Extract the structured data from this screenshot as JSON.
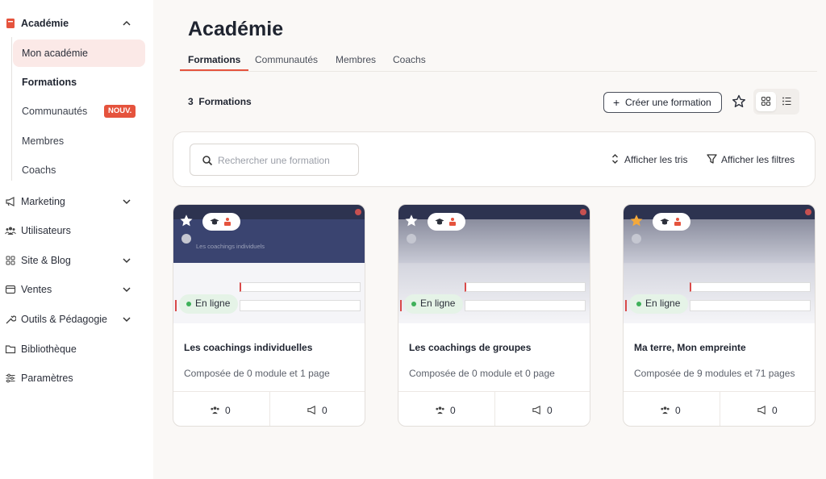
{
  "sidebar": {
    "group_title": "Académie",
    "sub_items": [
      "Mon académie",
      "Formations",
      "Communautés",
      "Membres",
      "Coachs"
    ],
    "new_badge": "NOUV.",
    "items": [
      "Marketing",
      "Utilisateurs",
      "Site & Blog",
      "Ventes",
      "Outils & Pédagogie",
      "Bibliothèque",
      "Paramètres"
    ]
  },
  "header": {
    "title": "Académie",
    "tabs": [
      "Formations",
      "Communautés",
      "Membres",
      "Coachs"
    ]
  },
  "toolbar": {
    "count_number": "3",
    "count_label": "Formations",
    "create_label": "Créer une formation"
  },
  "filters": {
    "search_placeholder": "Rechercher une formation",
    "sort_label": "Afficher les tris",
    "filter_label": "Afficher les filtres"
  },
  "cards": [
    {
      "title": "Les coachings individuelles",
      "subtitle": "Composée de 0 module et 1 page",
      "status": "En ligne",
      "users": "0",
      "campaigns": "0",
      "favorite": false,
      "hero_text": "Les coachings individuels"
    },
    {
      "title": "Les coachings de groupes",
      "subtitle": "Composée de 0 module et 0 page",
      "status": "En ligne",
      "users": "0",
      "campaigns": "0",
      "favorite": false,
      "hero_text": ""
    },
    {
      "title": "Ma terre, Mon empreinte",
      "subtitle": "Composée de 9 modules et 71 pages",
      "status": "En ligne",
      "users": "0",
      "campaigns": "0",
      "favorite": true,
      "hero_text": ""
    }
  ],
  "colors": {
    "accent": "#e5533d",
    "active_bg": "#fbe9e7",
    "online": "#3fb15a",
    "favorite_star": "#f4a93b"
  }
}
